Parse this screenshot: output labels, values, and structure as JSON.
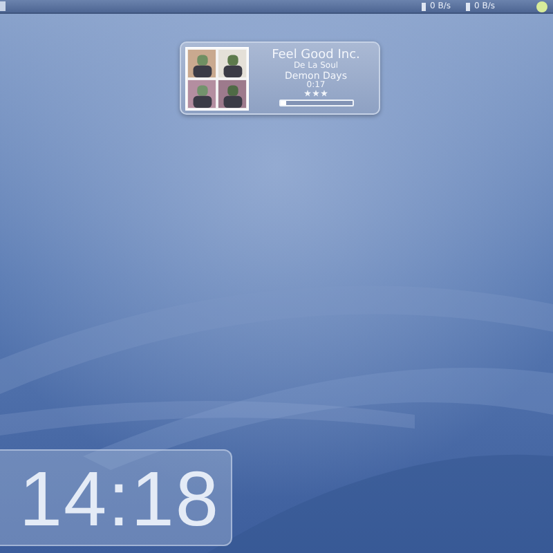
{
  "panel": {
    "network": [
      {
        "reading": "0 B/s"
      },
      {
        "reading": "0 B/s"
      }
    ]
  },
  "player": {
    "title": "Feel Good Inc.",
    "artist": "De La Soul",
    "album": "Demon Days",
    "elapsed": "0:17",
    "stars": 3,
    "level": 0.08
  },
  "clock": {
    "time": "14:18"
  }
}
